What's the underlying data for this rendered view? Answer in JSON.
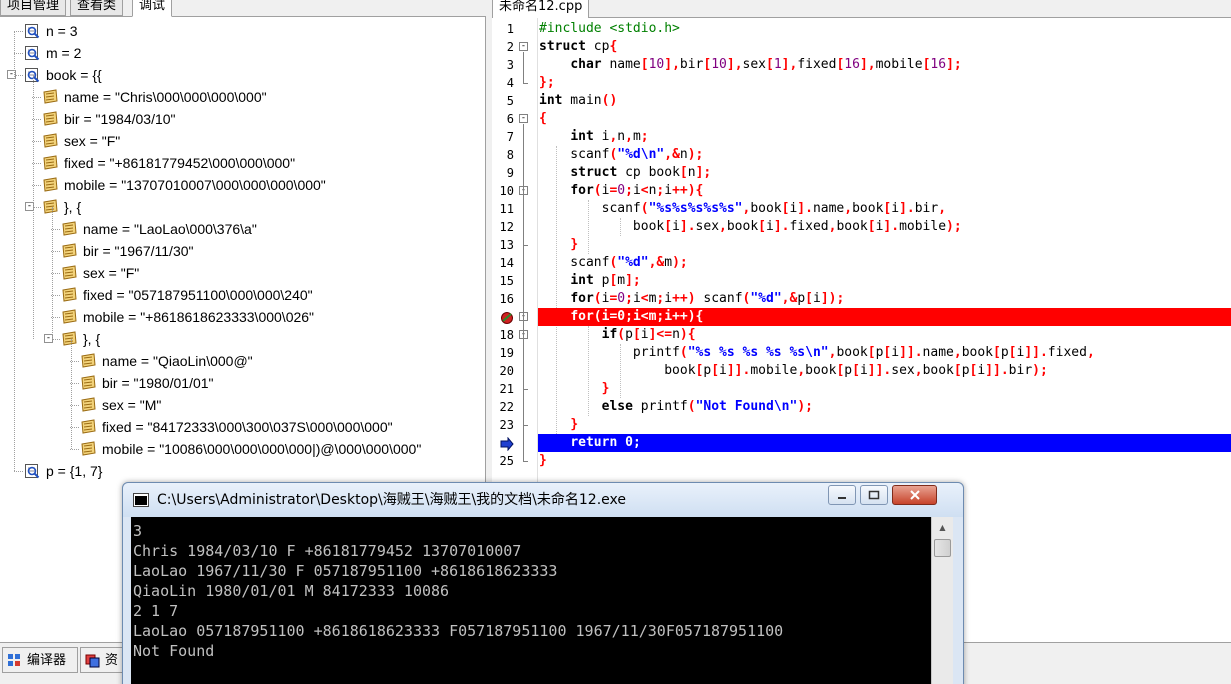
{
  "left_tabs": [
    "项目管理",
    "查看类",
    "调试"
  ],
  "watch_tree": [
    {
      "label": "n = 3"
    },
    {
      "label": "m = 2"
    },
    {
      "label": "book = {{"
    },
    {
      "label": "name = \"Chris\\000\\000\\000\\000\""
    },
    {
      "label": "bir = \"1984/03/10\""
    },
    {
      "label": "sex = \"F\""
    },
    {
      "label": "fixed = \"+86181779452\\000\\000\\000\""
    },
    {
      "label": "mobile = \"13707010007\\000\\000\\000\\000\""
    },
    {
      "label": "}, {"
    },
    {
      "label": "name = \"LaoLao\\000\\376\\a\""
    },
    {
      "label": "bir = \"1967/11/30\""
    },
    {
      "label": "sex = \"F\""
    },
    {
      "label": "fixed = \"057187951100\\000\\000\\240\""
    },
    {
      "label": "mobile = \"+8618618623333\\000\\026\""
    },
    {
      "label": "}, {"
    },
    {
      "label": "name = \"QiaoLin\\000@\""
    },
    {
      "label": "bir = \"1980/01/01\""
    },
    {
      "label": "sex = \"M\""
    },
    {
      "label": "fixed = \"84172333\\000\\300\\037S\\000\\000\\000\""
    },
    {
      "label": "mobile = \"10086\\000\\000\\000\\000|)@\\000\\000\\000\""
    },
    {
      "label": "p = {1, 7}"
    }
  ],
  "editor_tab": "未命名12.cpp",
  "code_lines": [
    [
      [
        "pp",
        "#include <stdio.h>"
      ]
    ],
    [
      [
        "kw",
        "struct"
      ],
      [
        "txt",
        " cp"
      ],
      [
        "sym",
        "{"
      ]
    ],
    [
      [
        "txt",
        "    "
      ],
      [
        "kw",
        "char"
      ],
      [
        "txt",
        " name"
      ],
      [
        "sym",
        "["
      ],
      [
        "num",
        "10"
      ],
      [
        "sym",
        "]"
      ],
      [
        "sym",
        ","
      ],
      [
        "txt",
        "bir"
      ],
      [
        "sym",
        "["
      ],
      [
        "num",
        "10"
      ],
      [
        "sym",
        "]"
      ],
      [
        "sym",
        ","
      ],
      [
        "txt",
        "sex"
      ],
      [
        "sym",
        "["
      ],
      [
        "num",
        "1"
      ],
      [
        "sym",
        "]"
      ],
      [
        "sym",
        ","
      ],
      [
        "txt",
        "fixed"
      ],
      [
        "sym",
        "["
      ],
      [
        "num",
        "16"
      ],
      [
        "sym",
        "]"
      ],
      [
        "sym",
        ","
      ],
      [
        "txt",
        "mobile"
      ],
      [
        "sym",
        "["
      ],
      [
        "num",
        "16"
      ],
      [
        "sym",
        "];"
      ]
    ],
    [
      [
        "sym",
        "};"
      ]
    ],
    [
      [
        "kw",
        "int"
      ],
      [
        "txt",
        " main"
      ],
      [
        "sym",
        "()"
      ]
    ],
    [
      [
        "sym",
        "{"
      ]
    ],
    [
      [
        "txt",
        "    "
      ],
      [
        "kw",
        "int"
      ],
      [
        "txt",
        " i"
      ],
      [
        "sym",
        ","
      ],
      [
        "txt",
        "n"
      ],
      [
        "sym",
        ","
      ],
      [
        "txt",
        "m"
      ],
      [
        "sym",
        ";"
      ]
    ],
    [
      [
        "txt",
        "    scanf"
      ],
      [
        "sym",
        "("
      ],
      [
        "str",
        "\"%d\\n\""
      ],
      [
        "sym",
        ",&"
      ],
      [
        "txt",
        "n"
      ],
      [
        "sym",
        ");"
      ]
    ],
    [
      [
        "txt",
        "    "
      ],
      [
        "kw",
        "struct"
      ],
      [
        "txt",
        " cp book"
      ],
      [
        "sym",
        "["
      ],
      [
        "txt",
        "n"
      ],
      [
        "sym",
        "];"
      ]
    ],
    [
      [
        "txt",
        "    "
      ],
      [
        "kw",
        "for"
      ],
      [
        "sym",
        "("
      ],
      [
        "txt",
        "i"
      ],
      [
        "sym",
        "="
      ],
      [
        "num",
        "0"
      ],
      [
        "sym",
        ";"
      ],
      [
        "txt",
        "i"
      ],
      [
        "sym",
        "<"
      ],
      [
        "txt",
        "n"
      ],
      [
        "sym",
        ";"
      ],
      [
        "txt",
        "i"
      ],
      [
        "sym",
        "++){"
      ]
    ],
    [
      [
        "txt",
        "        scanf"
      ],
      [
        "sym",
        "("
      ],
      [
        "str",
        "\"%s%s%s%s%s\""
      ],
      [
        "sym",
        ","
      ],
      [
        "txt",
        "book"
      ],
      [
        "sym",
        "["
      ],
      [
        "txt",
        "i"
      ],
      [
        "sym",
        "]."
      ],
      [
        "txt",
        "name"
      ],
      [
        "sym",
        ","
      ],
      [
        "txt",
        "book"
      ],
      [
        "sym",
        "["
      ],
      [
        "txt",
        "i"
      ],
      [
        "sym",
        "]."
      ],
      [
        "txt",
        "bir"
      ],
      [
        "sym",
        ","
      ]
    ],
    [
      [
        "txt",
        "            book"
      ],
      [
        "sym",
        "["
      ],
      [
        "txt",
        "i"
      ],
      [
        "sym",
        "]."
      ],
      [
        "txt",
        "sex"
      ],
      [
        "sym",
        ","
      ],
      [
        "txt",
        "book"
      ],
      [
        "sym",
        "["
      ],
      [
        "txt",
        "i"
      ],
      [
        "sym",
        "]."
      ],
      [
        "txt",
        "fixed"
      ],
      [
        "sym",
        ","
      ],
      [
        "txt",
        "book"
      ],
      [
        "sym",
        "["
      ],
      [
        "txt",
        "i"
      ],
      [
        "sym",
        "]."
      ],
      [
        "txt",
        "mobile"
      ],
      [
        "sym",
        ");"
      ]
    ],
    [
      [
        "txt",
        "    "
      ],
      [
        "sym",
        "}"
      ]
    ],
    [
      [
        "txt",
        "    scanf"
      ],
      [
        "sym",
        "("
      ],
      [
        "str",
        "\"%d\""
      ],
      [
        "sym",
        ",&"
      ],
      [
        "txt",
        "m"
      ],
      [
        "sym",
        ");"
      ]
    ],
    [
      [
        "txt",
        "    "
      ],
      [
        "kw",
        "int"
      ],
      [
        "txt",
        " p"
      ],
      [
        "sym",
        "["
      ],
      [
        "txt",
        "m"
      ],
      [
        "sym",
        "];"
      ]
    ],
    [
      [
        "txt",
        "    "
      ],
      [
        "kw",
        "for"
      ],
      [
        "sym",
        "("
      ],
      [
        "txt",
        "i"
      ],
      [
        "sym",
        "="
      ],
      [
        "num",
        "0"
      ],
      [
        "sym",
        ";"
      ],
      [
        "txt",
        "i"
      ],
      [
        "sym",
        "<"
      ],
      [
        "txt",
        "m"
      ],
      [
        "sym",
        ";"
      ],
      [
        "txt",
        "i"
      ],
      [
        "sym",
        "++)"
      ],
      [
        "txt",
        " scanf"
      ],
      [
        "sym",
        "("
      ],
      [
        "str",
        "\"%d\""
      ],
      [
        "sym",
        ",&"
      ],
      [
        "txt",
        "p"
      ],
      [
        "sym",
        "["
      ],
      [
        "txt",
        "i"
      ],
      [
        "sym",
        "]);"
      ]
    ],
    [
      [
        "txt",
        "    "
      ],
      [
        "kw",
        "for"
      ],
      [
        "sym",
        "("
      ],
      [
        "txt",
        "i"
      ],
      [
        "sym",
        "="
      ],
      [
        "num",
        "0"
      ],
      [
        "sym",
        ";"
      ],
      [
        "txt",
        "i"
      ],
      [
        "sym",
        "<"
      ],
      [
        "txt",
        "m"
      ],
      [
        "sym",
        ";"
      ],
      [
        "txt",
        "i"
      ],
      [
        "sym",
        "++){"
      ]
    ],
    [
      [
        "txt",
        "        "
      ],
      [
        "kw",
        "if"
      ],
      [
        "sym",
        "("
      ],
      [
        "txt",
        "p"
      ],
      [
        "sym",
        "["
      ],
      [
        "txt",
        "i"
      ],
      [
        "sym",
        "]<="
      ],
      [
        "txt",
        "n"
      ],
      [
        "sym",
        "){"
      ]
    ],
    [
      [
        "txt",
        "            printf"
      ],
      [
        "sym",
        "("
      ],
      [
        "str",
        "\"%s %s %s %s %s\\n\""
      ],
      [
        "sym",
        ","
      ],
      [
        "txt",
        "book"
      ],
      [
        "sym",
        "["
      ],
      [
        "txt",
        "p"
      ],
      [
        "sym",
        "["
      ],
      [
        "txt",
        "i"
      ],
      [
        "sym",
        "]]."
      ],
      [
        "txt",
        "name"
      ],
      [
        "sym",
        ","
      ],
      [
        "txt",
        "book"
      ],
      [
        "sym",
        "["
      ],
      [
        "txt",
        "p"
      ],
      [
        "sym",
        "["
      ],
      [
        "txt",
        "i"
      ],
      [
        "sym",
        "]]."
      ],
      [
        "txt",
        "fixed"
      ],
      [
        "sym",
        ","
      ]
    ],
    [
      [
        "txt",
        "                book"
      ],
      [
        "sym",
        "["
      ],
      [
        "txt",
        "p"
      ],
      [
        "sym",
        "["
      ],
      [
        "txt",
        "i"
      ],
      [
        "sym",
        "]]."
      ],
      [
        "txt",
        "mobile"
      ],
      [
        "sym",
        ","
      ],
      [
        "txt",
        "book"
      ],
      [
        "sym",
        "["
      ],
      [
        "txt",
        "p"
      ],
      [
        "sym",
        "["
      ],
      [
        "txt",
        "i"
      ],
      [
        "sym",
        "]]."
      ],
      [
        "txt",
        "sex"
      ],
      [
        "sym",
        ","
      ],
      [
        "txt",
        "book"
      ],
      [
        "sym",
        "["
      ],
      [
        "txt",
        "p"
      ],
      [
        "sym",
        "["
      ],
      [
        "txt",
        "i"
      ],
      [
        "sym",
        "]]."
      ],
      [
        "txt",
        "bir"
      ],
      [
        "sym",
        ");"
      ]
    ],
    [
      [
        "txt",
        "        "
      ],
      [
        "sym",
        "}"
      ]
    ],
    [
      [
        "txt",
        "        "
      ],
      [
        "kw",
        "else"
      ],
      [
        "txt",
        " printf"
      ],
      [
        "sym",
        "("
      ],
      [
        "str",
        "\"Not Found\\n\""
      ],
      [
        "sym",
        ");"
      ]
    ],
    [
      [
        "txt",
        "    "
      ],
      [
        "sym",
        "}"
      ]
    ],
    [
      [
        "txt",
        "    "
      ],
      [
        "kw",
        "return"
      ],
      [
        "txt",
        " "
      ],
      [
        "num",
        "0"
      ],
      [
        "sym",
        ";"
      ]
    ],
    [
      [
        "sym",
        "}"
      ]
    ]
  ],
  "line_numbers": [
    "1",
    "2",
    "3",
    "4",
    "5",
    "6",
    "7",
    "8",
    "9",
    "10",
    "11",
    "12",
    "13",
    "14",
    "15",
    "16",
    "17",
    "18",
    "19",
    "20",
    "21",
    "22",
    "23",
    "24",
    "25"
  ],
  "bottom_tabs": [
    "编译器",
    "资"
  ],
  "console": {
    "title": "C:\\Users\\Administrator\\Desktop\\海贼王\\海贼王\\我的文档\\未命名12.exe",
    "lines": [
      "3",
      "Chris 1984/03/10 F +86181779452 13707010007",
      "LaoLao 1967/11/30 F 057187951100 +8618618623333",
      "QiaoLin 1980/01/01 M 84172333 10086",
      "2 1 7",
      "LaoLao 057187951100 +8618618623333 F057187951100 1967/11/30F057187951100",
      "Not Found"
    ]
  },
  "colors": {
    "breakpoint_line": "#ff0000",
    "current_line": "#0000ff",
    "keyword": "#000000",
    "string": "#0000ff",
    "symbol": "#ff0000",
    "preprocessor": "#008000",
    "number": "#800080"
  }
}
